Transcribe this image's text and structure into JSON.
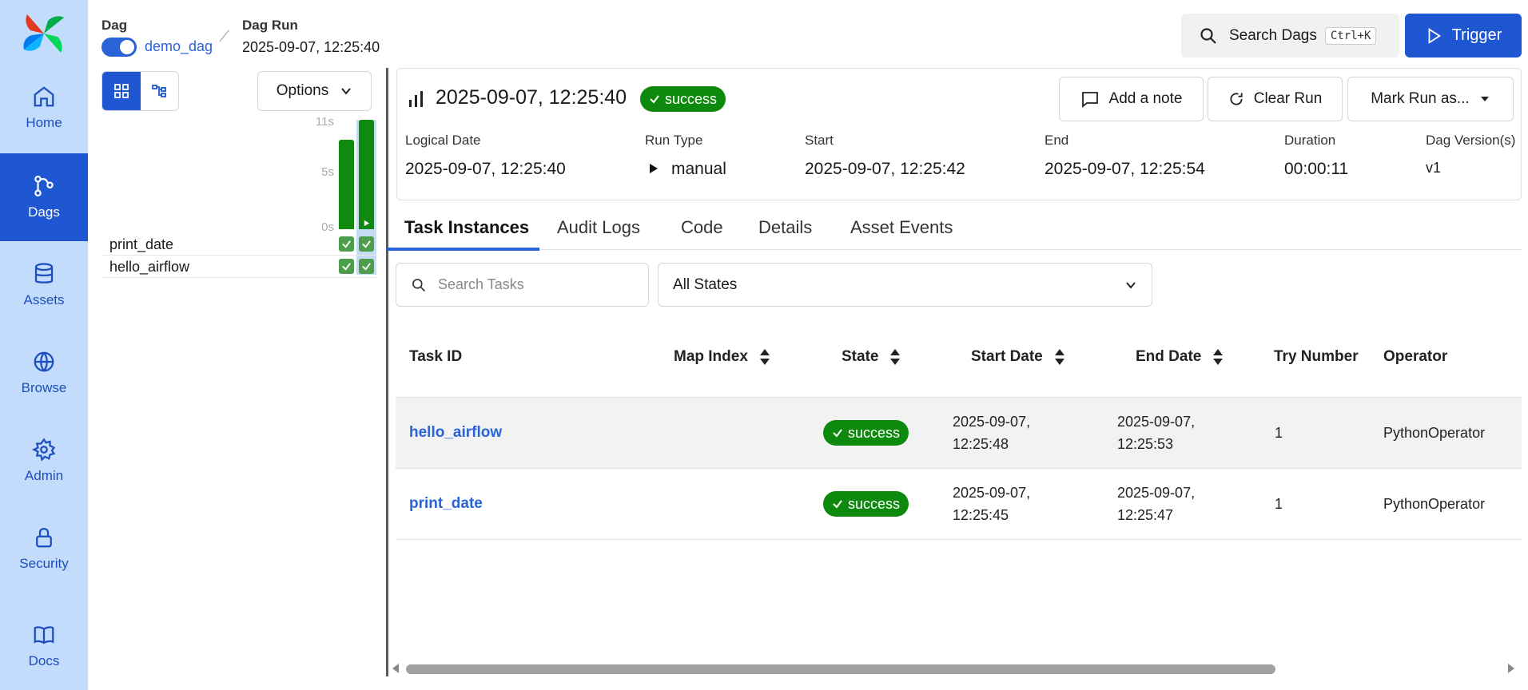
{
  "sidebar": {
    "items": [
      {
        "label": "Home",
        "icon": "home-icon"
      },
      {
        "label": "Dags",
        "icon": "dag-icon",
        "active": true
      },
      {
        "label": "Assets",
        "icon": "database-icon"
      },
      {
        "label": "Browse",
        "icon": "globe-icon"
      },
      {
        "label": "Admin",
        "icon": "gear-icon"
      },
      {
        "label": "Security",
        "icon": "lock-icon"
      },
      {
        "label": "Docs",
        "icon": "book-icon"
      }
    ]
  },
  "breadcrumb": {
    "dag_label": "Dag",
    "dag_name": "demo_dag",
    "run_label": "Dag Run",
    "run_value": "2025-09-07, 12:25:40"
  },
  "topbar": {
    "search_label": "Search Dags",
    "search_shortcut": "Ctrl+K",
    "trigger_label": "Trigger"
  },
  "grid": {
    "options_label": "Options",
    "axis_ticks": [
      "11s",
      "5s",
      "0s"
    ],
    "run_durations_s": [
      9,
      11
    ],
    "tasks": [
      "print_date",
      "hello_airflow"
    ]
  },
  "run": {
    "title": "2025-09-07, 12:25:40",
    "state": "success",
    "actions": {
      "note": "Add a note",
      "clear": "Clear Run",
      "mark": "Mark Run as..."
    },
    "meta": [
      {
        "label": "Logical Date",
        "value": "2025-09-07, 12:25:40"
      },
      {
        "label": "Run Type",
        "value": "manual"
      },
      {
        "label": "Start",
        "value": "2025-09-07, 12:25:42"
      },
      {
        "label": "End",
        "value": "2025-09-07, 12:25:54"
      },
      {
        "label": "Duration",
        "value": "00:00:11"
      },
      {
        "label": "Dag Version(s)",
        "value": "v1"
      }
    ]
  },
  "tabs": [
    "Task Instances",
    "Audit Logs",
    "Code",
    "Details",
    "Asset Events"
  ],
  "filters": {
    "search_placeholder": "Search Tasks",
    "state_value": "All States"
  },
  "table": {
    "headers": [
      "Task ID",
      "Map Index",
      "State",
      "Start Date",
      "End Date",
      "Try Number",
      "Operator"
    ],
    "rows": [
      {
        "task_id": "hello_airflow",
        "state": "success",
        "start_1": "2025-09-07,",
        "start_2": "12:25:48",
        "end_1": "2025-09-07,",
        "end_2": "12:25:53",
        "try": "1",
        "operator": "PythonOperator"
      },
      {
        "task_id": "print_date",
        "state": "success",
        "start_1": "2025-09-07,",
        "start_2": "12:25:45",
        "end_1": "2025-09-07,",
        "end_2": "12:25:47",
        "try": "1",
        "operator": "PythonOperator"
      }
    ]
  },
  "colors": {
    "sidebar_bg": "#c4dcfb",
    "accent": "#1f56d1",
    "success": "#0d8a0d"
  }
}
